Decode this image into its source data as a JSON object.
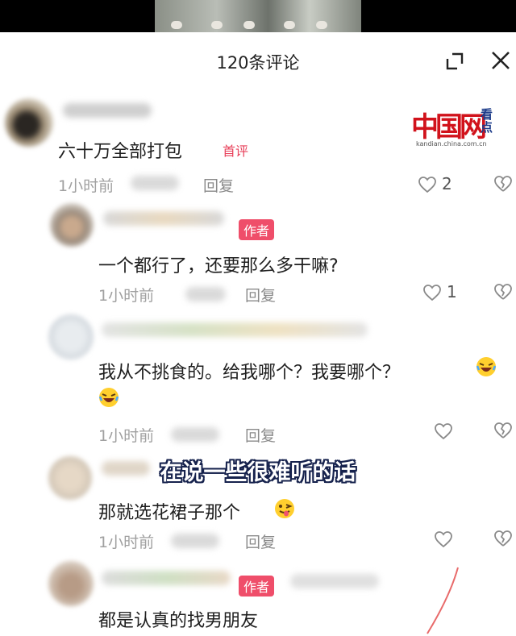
{
  "header": {
    "title": "120条评论"
  },
  "watermark": {
    "logo_text": "中国网",
    "corner_text": "看点",
    "site": "kandian.china.com.cn"
  },
  "subtitle": "在说一些很难听的话",
  "comments": [
    {
      "text": "六十万全部打包",
      "badge": "首评",
      "time": "1小时前",
      "reply": "回复",
      "likes": "2"
    },
    {
      "badge": "作者",
      "text": "一个都行了，还要那么多干嘛?",
      "time": "1小时前",
      "reply": "回复",
      "likes": "1"
    },
    {
      "text_line1": "我从不挑食的。给我哪个？我要哪个？",
      "time": "1小时前",
      "reply": "回复",
      "likes": ""
    },
    {
      "text": "那就选花裙子那个",
      "time": "1小时前",
      "reply": "回复",
      "likes": ""
    },
    {
      "badge": "作者",
      "text": "都是认真的找男朋友"
    }
  ],
  "icons": {
    "expand": "expand-icon",
    "close": "close-icon",
    "like": "heart-icon",
    "dislike": "broken-heart-icon",
    "laugh": "laughing-emoji-icon",
    "wink": "winking-tongue-emoji-icon"
  }
}
